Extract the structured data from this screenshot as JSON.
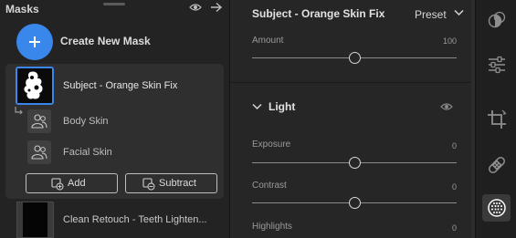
{
  "masks_panel": {
    "title": "Masks",
    "create_label": "Create New Mask",
    "selected_mask": {
      "label": "Subject - Orange Skin Fix",
      "components": [
        {
          "label": "Body Skin"
        },
        {
          "label": "Facial Skin"
        }
      ],
      "add_label": "Add",
      "subtract_label": "Subtract"
    },
    "other_mask": {
      "label": "Clean Retouch - Teeth Lighten..."
    }
  },
  "adjust_panel": {
    "title": "Subject - Orange Skin Fix",
    "preset_label": "Preset",
    "amount": {
      "label": "Amount",
      "value": "100",
      "fraction": 0.5
    },
    "light_section": {
      "label": "Light",
      "sliders": [
        {
          "label": "Exposure",
          "value": "0",
          "fraction": 0.5
        },
        {
          "label": "Contrast",
          "value": "0",
          "fraction": 0.5
        },
        {
          "label": "Highlights",
          "value": "0",
          "fraction": 0.5
        }
      ]
    }
  },
  "tool_strip": {
    "tools": [
      "presets-icon",
      "edit-sliders-icon",
      "crop-icon",
      "healing-bandage-icon",
      "masking-icon"
    ],
    "active": "masking-icon"
  },
  "colors": {
    "accent": "#3a87ec",
    "panel": "#262626",
    "text": "#cfcfcf"
  }
}
